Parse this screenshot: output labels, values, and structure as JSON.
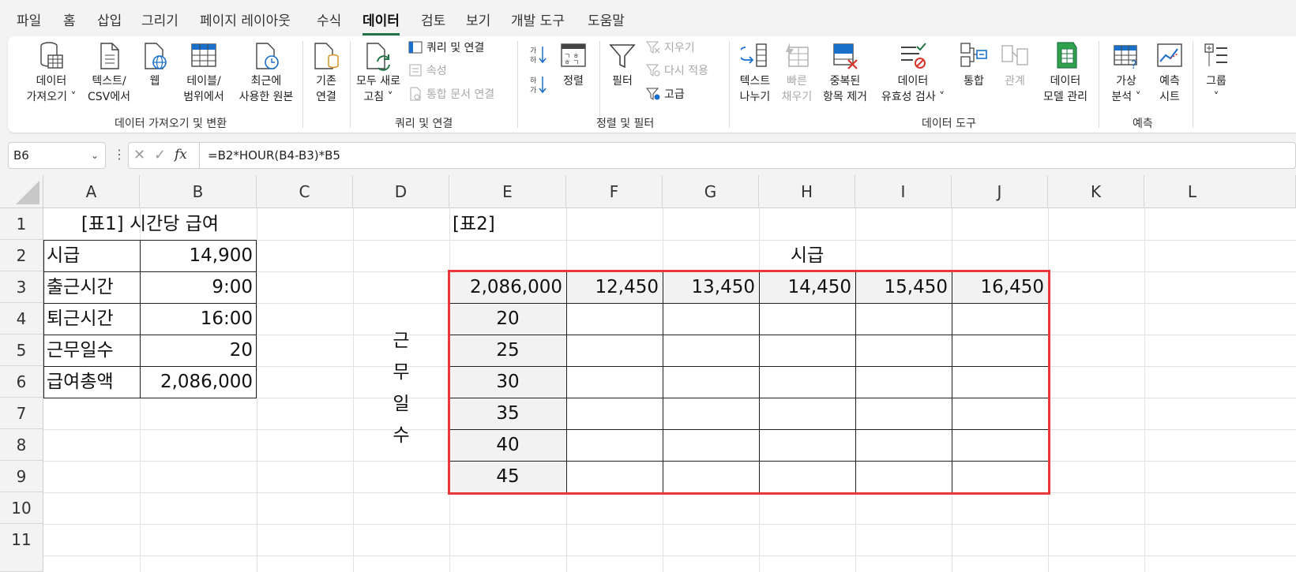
{
  "menu": {
    "tabs": [
      "파일",
      "홈",
      "삽입",
      "그리기",
      "페이지 레이아웃",
      "수식",
      "데이터",
      "검토",
      "보기",
      "개발 도구",
      "도움말"
    ],
    "active": "데이터"
  },
  "ribbon": {
    "get_data": [
      "데이터",
      "가져오기 ˅"
    ],
    "text_csv": [
      "텍스트/",
      "CSV에서"
    ],
    "web": "웹",
    "from_table": [
      "테이블/",
      "범위에서"
    ],
    "recent_sources": [
      "최근에",
      "사용한 원본"
    ],
    "existing_conn": [
      "기존",
      "연결"
    ],
    "group_get_transform": "데이터 가져오기 및 변환",
    "refresh_all": [
      "모두 새로",
      "고침 ˅"
    ],
    "queries_conn": "쿼리 및 연결",
    "properties": "속성",
    "edit_links": "통합 문서 연결",
    "group_queries": "쿼리 및 연결",
    "sort_az": "정렬",
    "filter": "필터",
    "clear": "지우기",
    "reapply": "다시 적용",
    "advanced": "고급",
    "group_sort_filter": "정렬 및 필터",
    "text_to_cols": [
      "텍스트",
      "나누기"
    ],
    "flash_fill": [
      "빠른",
      "채우기"
    ],
    "remove_dup": [
      "중복된",
      "항목 제거"
    ],
    "data_validation": [
      "데이터",
      "유효성 검사 ˅"
    ],
    "consolidate": "통합",
    "relationships": "관계",
    "data_model": [
      "데이터",
      "모델 관리"
    ],
    "group_data_tools": "데이터 도구",
    "what_if": [
      "가상",
      "분석 ˅"
    ],
    "forecast_sheet": [
      "예측",
      "시트"
    ],
    "group_forecast": "예측",
    "group": [
      "그룹",
      "˅"
    ]
  },
  "formula_bar": {
    "name_box": "B6",
    "formula": "=B2*HOUR(B4-B3)*B5"
  },
  "columns": [
    "A",
    "B",
    "C",
    "D",
    "E",
    "F",
    "G",
    "H",
    "I",
    "J",
    "K",
    "L"
  ],
  "rows": [
    "1",
    "2",
    "3",
    "4",
    "5",
    "6",
    "7",
    "8",
    "9",
    "10",
    "11"
  ],
  "table1": {
    "title": "[표1]  시간당 급여",
    "labels": [
      "시급",
      "출근시간",
      "퇴근시간",
      "근무일수",
      "급여총액"
    ],
    "values": [
      "14,900",
      "9:00",
      "16:00",
      "20",
      "2,086,000"
    ]
  },
  "table2": {
    "title": "[표2]",
    "header": "시급",
    "corner": "2,086,000",
    "wages": [
      "12,450",
      "13,450",
      "14,450",
      "15,450",
      "16,450"
    ],
    "days": [
      "20",
      "25",
      "30",
      "35",
      "40",
      "45"
    ],
    "side_label": [
      "근",
      "무",
      "일",
      "수"
    ]
  }
}
